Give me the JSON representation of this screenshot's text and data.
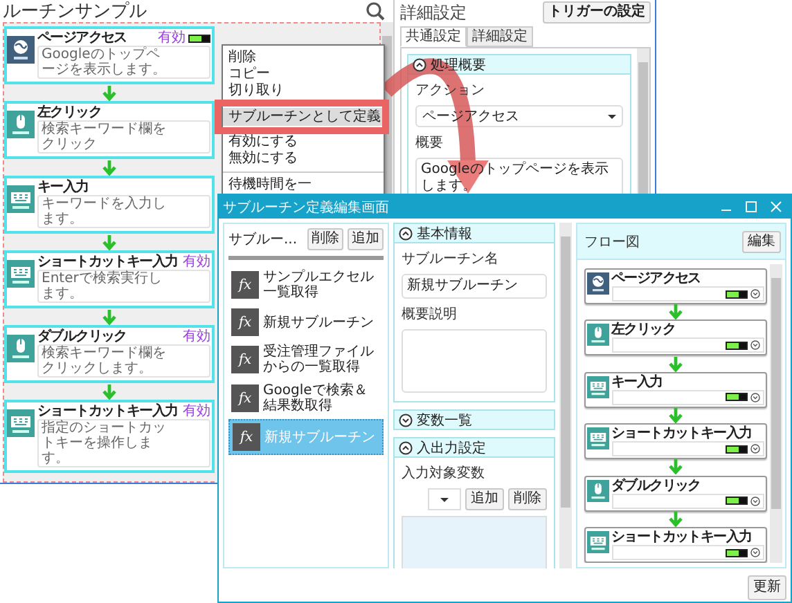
{
  "main_window": {
    "title": "ルーチンサンプル",
    "flow_steps": [
      {
        "kind": "web",
        "title": "ページアクセス",
        "description": "Googleのトップページを表示します。",
        "badge": "有効",
        "switch_on": true
      },
      {
        "kind": "mouse",
        "title": "左クリック",
        "description": "検索キーワード欄をクリック"
      },
      {
        "kind": "keyboard",
        "title": "キー入力",
        "description": "キーワードを入力します。"
      },
      {
        "kind": "keyboard",
        "title": "ショートカットキー入力",
        "description": "Enterで検索実行します。",
        "badge": "有効"
      },
      {
        "kind": "mouse",
        "title": "ダブルクリック",
        "description": "検索キーワード欄をクリックします。",
        "badge": "有効"
      },
      {
        "kind": "keyboard",
        "title": "ショートカットキー入力",
        "description": "指定のショートカットキーを操作します。",
        "badge": "有効"
      }
    ]
  },
  "detail_panel": {
    "title": "詳細設定",
    "trigger_button": "トリガーの設定",
    "tabs": [
      {
        "label": "共通設定",
        "selected": true
      },
      {
        "label": "詳細設定",
        "selected": false
      }
    ],
    "section": {
      "title": "処理概要",
      "expanded": true
    },
    "action_label": "アクション",
    "action_value": "ページアクセス",
    "summary_label": "概要",
    "summary_value": "Googleのトップページを表示します。"
  },
  "context_menu": {
    "items": [
      {
        "label": "削除",
        "selected": false
      },
      {
        "label": "コピー",
        "selected": false
      },
      {
        "label": "切り取り",
        "selected": false
      },
      {
        "label": "サブルーチンとして定義",
        "selected": true
      },
      {
        "label": "有効にする",
        "selected": false
      },
      {
        "label": "無効にする",
        "selected": false
      },
      {
        "label": "待機時間を一",
        "selected": false,
        "separator_before": true
      }
    ]
  },
  "subroutine_window": {
    "title": "サブルーチン定義編集画面",
    "list_title": "サブルー...",
    "list_buttons": [
      "削除",
      "追加"
    ],
    "subroutines": [
      {
        "icon_label": "fx",
        "name": "サンプルエクセル一覧取得",
        "selected": false
      },
      {
        "icon_label": "fx",
        "name": "新規サブルーチン",
        "selected": false
      },
      {
        "icon_label": "fx",
        "name": "受注管理ファイルからの一覧取得",
        "selected": false
      },
      {
        "icon_label": "fx",
        "name": "Googleで検索＆結果数取得",
        "selected": false
      },
      {
        "icon_label": "fx",
        "name": "新規サブルーチン",
        "selected": true
      }
    ],
    "basic_section": {
      "title": "基本情報",
      "expanded": true
    },
    "name_label": "サブルーチン名",
    "name_value": "新規サブルーチン",
    "description_label": "概要説明",
    "variables_section": {
      "title": "変数一覧",
      "expanded": false
    },
    "io_section": {
      "title": "入出力設定",
      "expanded": true
    },
    "input_label": "入力対象変数",
    "input_buttons": [
      "追加",
      "削除"
    ],
    "flow_title": "フロー図",
    "edit_button": "編集",
    "flow_steps": [
      {
        "kind": "web",
        "title": "ページアクセス",
        "switch_on": true
      },
      {
        "kind": "mouse",
        "title": "左クリック",
        "switch_on": true
      },
      {
        "kind": "keyboard",
        "title": "キー入力",
        "switch_on": true
      },
      {
        "kind": "keyboard",
        "title": "ショートカットキー入力",
        "switch_on": true
      },
      {
        "kind": "mouse",
        "title": "ダブルクリック",
        "switch_on": true
      },
      {
        "kind": "keyboard",
        "title": "ショートカットキー入力",
        "switch_on": true
      }
    ],
    "update_button": "更新"
  }
}
